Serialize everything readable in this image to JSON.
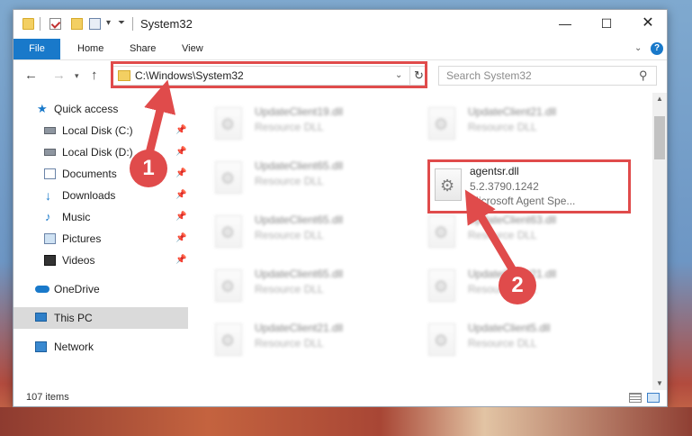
{
  "window": {
    "title": "System32",
    "controls": {
      "minimize": "—",
      "maximize": "☐",
      "close": "✕"
    }
  },
  "ribbon": {
    "tabs": [
      {
        "label": "File"
      },
      {
        "label": "Home"
      },
      {
        "label": "Share"
      },
      {
        "label": "View"
      }
    ],
    "help": "?"
  },
  "address_bar": {
    "path": "C:\\Windows\\System32"
  },
  "search": {
    "placeholder": "Search System32"
  },
  "sidebar": {
    "items": [
      {
        "label": "Quick access",
        "icon": "star-icon"
      },
      {
        "label": "Local Disk (C:)",
        "icon": "disk-icon",
        "pinned": true
      },
      {
        "label": "Local Disk (D:)",
        "icon": "disk-icon",
        "pinned": true
      },
      {
        "label": "Documents",
        "icon": "documents-icon",
        "pinned": true
      },
      {
        "label": "Downloads",
        "icon": "downloads-icon",
        "pinned": true
      },
      {
        "label": "Music",
        "icon": "music-icon",
        "pinned": true
      },
      {
        "label": "Pictures",
        "icon": "pictures-icon",
        "pinned": true
      },
      {
        "label": "Videos",
        "icon": "videos-icon",
        "pinned": true
      },
      {
        "label": "OneDrive",
        "icon": "onedrive-icon"
      },
      {
        "label": "This PC",
        "icon": "pc-icon",
        "selected": true
      },
      {
        "label": "Network",
        "icon": "network-icon"
      }
    ]
  },
  "files": {
    "left_column": [
      {
        "name": "UpdateClient19.dll",
        "desc": "Resource DLL"
      },
      {
        "name": "UpdateClient65.dll",
        "desc": "Resource DLL"
      },
      {
        "name": "UpdateClient65.dll",
        "desc": "Resource DLL"
      },
      {
        "name": "UpdateClient65.dll",
        "desc": "Resource DLL"
      },
      {
        "name": "UpdateClient21.dll",
        "desc": "Resource DLL"
      }
    ],
    "right_column": [
      {
        "name": "UpdateClient21.dll",
        "desc": "Resource DLL"
      },
      {
        "name": "UpdateClient63.dll",
        "desc": "Resource DLL"
      },
      {
        "name": "UpdateClient21.dll",
        "desc": "Resource DLL"
      },
      {
        "name": "UpdateClient5.dll",
        "desc": "Resource DLL"
      }
    ],
    "highlighted": {
      "name": "agentsr.dll",
      "version": "5.2.3790.1242",
      "desc": "Microsoft Agent Spe..."
    }
  },
  "status": {
    "item_count": "107 items"
  },
  "annotations": {
    "step1": "1",
    "step2": "2",
    "color": "#e04b4b"
  }
}
